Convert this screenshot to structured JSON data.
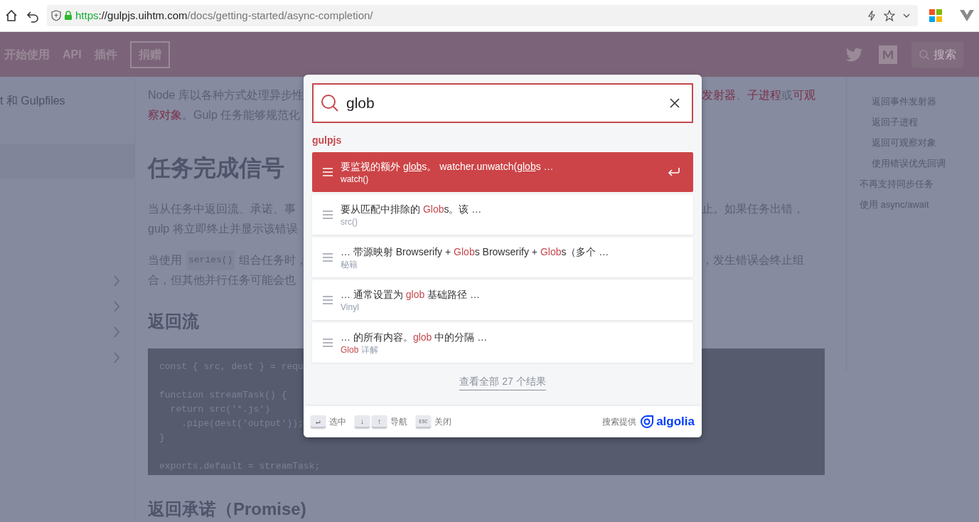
{
  "browser": {
    "url": {
      "scheme": "https",
      "host": "://gulpjs.uihtm.com",
      "path": "/docs/getting-started/async-completion/"
    }
  },
  "header": {
    "nav": [
      {
        "label": "开始使用",
        "boxed": false
      },
      {
        "label": "API",
        "boxed": false
      },
      {
        "label": "插件",
        "boxed": false
      },
      {
        "label": "捐赠",
        "boxed": true
      }
    ],
    "search_label": "搜索"
  },
  "sidebar": {
    "item": "t 和 Gulpfiles"
  },
  "content": {
    "paragraph_1": {
      "left": [
        "Node 库以各种方式处理异步性",
        "**察对象**。Gulp 任务能够规范化"
      ],
      "right": "**发射器**、**子进程**或**可观**"
    },
    "heading_1": "任务完成信号",
    "paragraph_2": {
      "left": [
        "当从任务中返回流、承诺、事",
        "gulp 将立即终止并显示该错误"
      ],
      "right": "止。如果任务出错，"
    },
    "paragraph_3": {
      "left_prefix": "当使用",
      "left_code": "series()",
      "left_suffix": "组合任务时，",
      "left_line_2": "合，但其他并行任务可能会也",
      "right": "，发生错误会终止组"
    },
    "heading_2": "返回流",
    "code_blocks": [
      [
        "const { src, dest } = requ"
      ],
      [
        "function streamTask() {",
        "  return src('*.js')",
        "    .pipe(dest('output'));",
        "}"
      ],
      [
        "exports.default = streamTask;"
      ]
    ],
    "heading_3": "返回承诺（Promise)"
  },
  "toc": [
    {
      "label": "返回事件发射器",
      "children": true
    },
    {
      "label": "返回子进程",
      "children": true
    },
    {
      "label": "返回可观察对象",
      "children": true
    },
    {
      "label": "使用错误优先回调",
      "children": true
    },
    {
      "label": "不再支持同步任务",
      "children": false
    },
    {
      "label": "使用 async/await",
      "children": false
    }
  ],
  "search_modal": {
    "query": "glob",
    "source": "gulpjs",
    "hits": [
      {
        "title": "要监视的额外 **glob**s。 watcher.unwatch(**glob**s …",
        "subtitle": "watch()",
        "selected": true
      },
      {
        "title": "要从匹配中排除的 **Glob**s。该 …",
        "subtitle": "src()",
        "selected": false
      },
      {
        "title": "… 带源映射 Browserify + **Glob**s Browserify + **Glob**s（多个 …",
        "subtitle": "秘籍",
        "selected": false
      },
      {
        "title": "… 通常设置为 **glob** 基础路径 …",
        "subtitle": "Vinyl",
        "selected": false
      },
      {
        "title": "… 的所有内容。**glob** 中的分隔 …",
        "subtitle": "**Glob** 详解",
        "selected": false
      }
    ],
    "see_all": "查看全部 27 个结果",
    "commands": [
      {
        "keys": [
          "↵"
        ],
        "label": "选中"
      },
      {
        "keys": [
          "↓",
          "↑"
        ],
        "label": "导航"
      },
      {
        "keys": [
          "ESC"
        ],
        "label": "关闭"
      }
    ],
    "powered_by": "搜索提供",
    "brand": "algolia"
  }
}
